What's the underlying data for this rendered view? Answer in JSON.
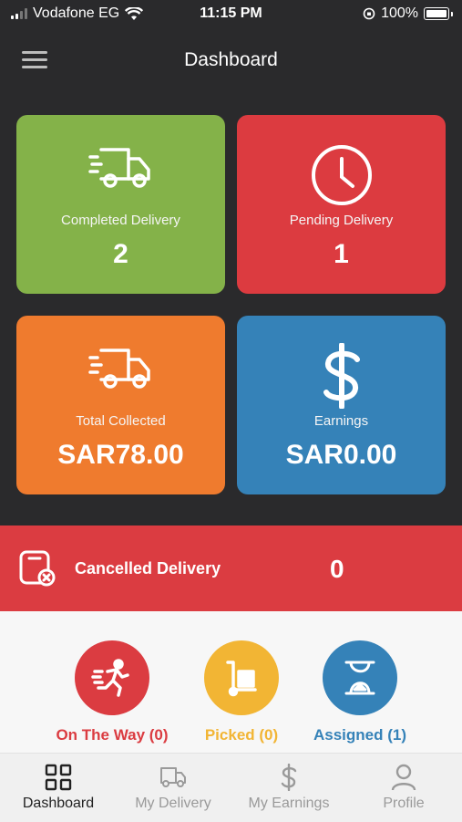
{
  "status_bar": {
    "carrier": "Vodafone EG",
    "time": "11:15 PM",
    "battery": "100%"
  },
  "header": {
    "title": "Dashboard"
  },
  "cards": {
    "completed": {
      "label": "Completed Delivery",
      "value": "2",
      "color": "#84b249",
      "icon": "delivery-truck-icon"
    },
    "pending": {
      "label": "Pending Delivery",
      "value": "1",
      "color": "#dc3b40",
      "icon": "clock-icon"
    },
    "collected": {
      "label": "Total Collected",
      "value": "SAR78.00",
      "color": "#ef7b2e",
      "icon": "delivery-truck-icon"
    },
    "earnings": {
      "label": "Earnings",
      "value": "SAR0.00",
      "color": "#3582b8",
      "icon": "dollar-icon"
    }
  },
  "cancelled": {
    "label": "Cancelled Delivery",
    "value": "0",
    "color": "#db3c41",
    "icon": "cancelled-box-icon"
  },
  "statuses": {
    "on_the_way": {
      "label": "On The Way (0)",
      "color": "#db3c41",
      "icon": "running-person-icon"
    },
    "picked": {
      "label": "Picked (0)",
      "color": "#f2b534",
      "icon": "hand-truck-icon"
    },
    "assigned": {
      "label": "Assigned (1)",
      "color": "#3582b8",
      "icon": "hourglass-icon"
    }
  },
  "tabs": {
    "dashboard": {
      "label": "Dashboard",
      "icon": "grid-icon"
    },
    "my_delivery": {
      "label": "My Delivery",
      "icon": "truck-icon"
    },
    "my_earnings": {
      "label": "My Earnings",
      "icon": "dollar-icon"
    },
    "profile": {
      "label": "Profile",
      "icon": "person-icon"
    }
  }
}
